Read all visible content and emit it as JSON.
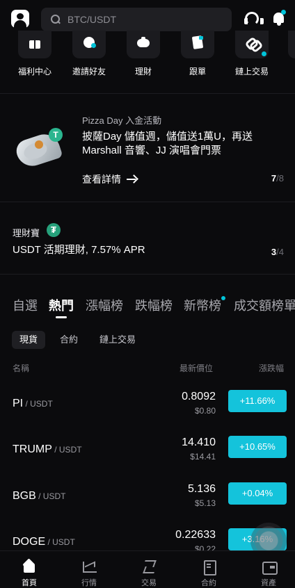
{
  "search": {
    "placeholder": "BTC/USDT"
  },
  "quick_menu": [
    {
      "label": "福利中心",
      "icon": "gift-icon"
    },
    {
      "label": "邀請好友",
      "icon": "invite-icon"
    },
    {
      "label": "理財",
      "icon": "piggy-bank-icon"
    },
    {
      "label": "跟單",
      "icon": "copy-trade-icon"
    },
    {
      "label": "鏈上交易",
      "icon": "chain-link-icon"
    }
  ],
  "promo": {
    "subtitle": "Pizza Day 入金活動",
    "title": "披薩Day 儲值週，儲值送1萬U，再送 Marshall 音響、JJ 演唱會門票",
    "cta": "查看詳情",
    "pager_current": "7",
    "pager_total": "/8"
  },
  "earn": {
    "label": "理財寶",
    "title": "USDT 活期理財, 7.57% APR",
    "pager_current": "3",
    "pager_total": "/4"
  },
  "tabs": [
    "自選",
    "熱門",
    "漲幅榜",
    "跌幅榜",
    "新幣榜",
    "成交額榜單"
  ],
  "active_tab": "熱門",
  "subtabs": [
    "現貨",
    "合約",
    "鏈上交易"
  ],
  "columns": {
    "name": "名稱",
    "price": "最新價位",
    "change": "漲跌幅"
  },
  "rows": [
    {
      "base": "PI",
      "quote": " / USDT",
      "price": "0.8092",
      "fiat": "$0.80",
      "change": "+11.66%"
    },
    {
      "base": "TRUMP",
      "quote": " / USDT",
      "price": "14.410",
      "fiat": "$14.41",
      "change": "+10.65%"
    },
    {
      "base": "BGB",
      "quote": " / USDT",
      "price": "5.136",
      "fiat": "$5.13",
      "change": "+0.04%"
    },
    {
      "base": "DOGE",
      "quote": " / USDT",
      "price": "0.22633",
      "fiat": "$0.22",
      "change": "+3.16%"
    }
  ],
  "bottom_nav": [
    {
      "label": "首頁",
      "icon": "home-icon"
    },
    {
      "label": "行情",
      "icon": "market-chart-icon"
    },
    {
      "label": "交易",
      "icon": "trade-icon"
    },
    {
      "label": "合約",
      "icon": "futures-icon"
    },
    {
      "label": "資產",
      "icon": "wallet-icon"
    }
  ],
  "colors": {
    "accent": "#14c3db",
    "background": "#0b0b0d",
    "tether": "#26a17b"
  }
}
